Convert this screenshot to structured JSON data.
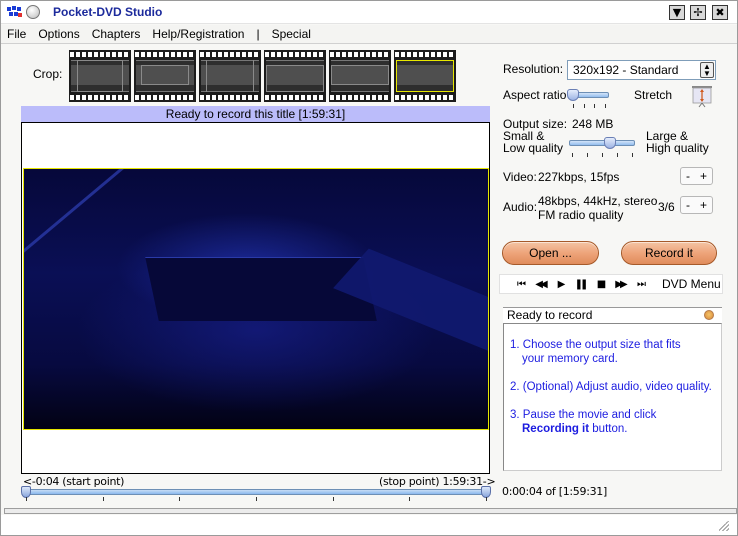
{
  "window": {
    "title": "Pocket-DVD Studio",
    "controls": [
      {
        "name": "minimize-button",
        "glyph": "▼"
      },
      {
        "name": "restore-button",
        "glyph": "✢"
      },
      {
        "name": "close-button",
        "glyph": "✖"
      }
    ]
  },
  "menu": {
    "items": [
      "File",
      "Options",
      "Chapters",
      "Help/Registration",
      "|",
      "Special"
    ]
  },
  "crop": {
    "label": "Crop:",
    "presets": [
      "crop-preset-1",
      "crop-preset-2",
      "crop-preset-3",
      "crop-preset-4",
      "crop-preset-5",
      "crop-preset-6"
    ],
    "selected_index": 5
  },
  "preview": {
    "status": "Ready to record this title [1:59:31]"
  },
  "range": {
    "start_label": "<-0:04 (start point)",
    "stop_label": "(stop point) 1:59:31->",
    "start_fraction": 0.0,
    "stop_fraction": 1.0,
    "tick_count": 7
  },
  "settings": {
    "resolution_label": "Resolution:",
    "resolution_value": "320x192 - Standard",
    "aspect_label": "Aspect ratio",
    "aspect_right_label": "Stretch",
    "aspect_fraction": 0.0,
    "output_size_label": "Output size:",
    "output_size_value": "248 MB",
    "size_left_label_1": "Small &",
    "size_left_label_2": "Low quality",
    "size_right_label_1": "Large &",
    "size_right_label_2": "High quality",
    "size_fraction": 0.6,
    "video_label": "Video:",
    "video_value": "227kbps, 15fps",
    "audio_label": "Audio:",
    "audio_value_1": "48kbps, 44kHz, stereo",
    "audio_value_2": "FM radio quality",
    "audio_level": "3/6",
    "minus": "-",
    "plus": "+"
  },
  "actions": {
    "open_label": "Open ...",
    "record_label": "Record it"
  },
  "transport": {
    "buttons": [
      {
        "name": "skip-back-button",
        "glyph": "⏮"
      },
      {
        "name": "rewind-button",
        "glyph": "◀◀"
      },
      {
        "name": "play-button",
        "glyph": "▶"
      },
      {
        "name": "pause-button",
        "glyph": "❚❚"
      },
      {
        "name": "stop-button",
        "glyph": "■"
      },
      {
        "name": "fast-forward-button",
        "glyph": "▶▶"
      },
      {
        "name": "skip-forward-button",
        "glyph": "⏭"
      }
    ],
    "dvd_menu_label": "DVD Menu"
  },
  "info": {
    "header": "Ready to record",
    "step1a": "1. Choose the output size that fits",
    "step1b": "your memory card.",
    "step2": "2. (Optional) Adjust audio, video quality.",
    "step3a": "3. Pause the movie and click",
    "step3b_bold": "Recording it",
    "step3b_rest": " button."
  },
  "playback": {
    "time_readout": "0:00:04 of [1:59:31]"
  }
}
